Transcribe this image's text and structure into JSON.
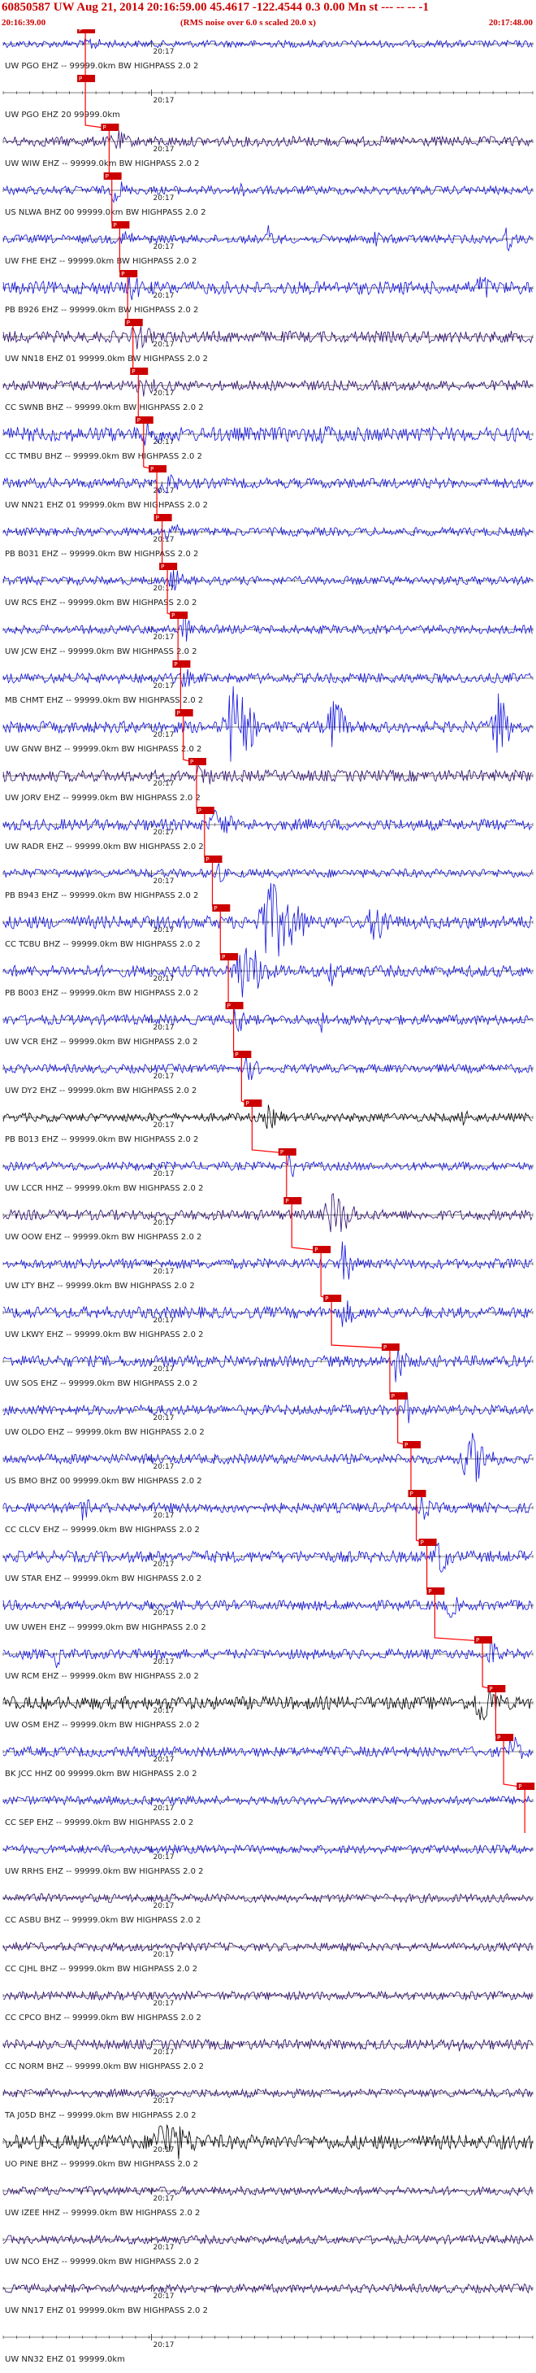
{
  "header": {
    "title": "60850587 UW Aug 21, 2014 20:16:59.00    45.4617 -122.4544   0.3  0.00  Mn st --- -- --   -1",
    "start_time": "20:16:39.00",
    "note": "(RMS noise over 6.0 s scaled 20.0 x)",
    "end_time": "20:17:48.00"
  },
  "colors": {
    "trace_blue": "#1010e0",
    "trace_purple": "#2c0a6e",
    "trace_black": "#000000",
    "pick_red": "#ff0000",
    "pick_box": "#cc0000"
  },
  "chart_data": {
    "type": "seismogram",
    "x_start": "20:16:39.00",
    "x_end": "20:17:48.00",
    "minute_tick": "20:17",
    "traces": [
      {
        "label": "UW PGO EHZ -- 99999.0km BW  HIGHPASS  2.0  2",
        "pick": 0.155,
        "amp": 0.25,
        "color": "blue",
        "bursts": [
          [
            0.16,
            0.05,
            0.6
          ]
        ]
      },
      {
        "label": "UW PGO EHZ 20 99999.0km",
        "pick": 0.155,
        "amp": 0.0,
        "color": "blue",
        "bursts": []
      },
      {
        "label": "UW WIW EHZ -- 99999.0km BW  HIGHPASS  2.0  2",
        "pick": 0.2,
        "amp": 0.35,
        "color": "purple",
        "bursts": [
          [
            0.21,
            0.05,
            0.9
          ],
          [
            0.55,
            0.03,
            0.6
          ]
        ]
      },
      {
        "label": "US NLWA BHZ 00 99999.0km BW  HIGHPASS  2.0  2",
        "pick": 0.205,
        "amp": 0.3,
        "color": "blue",
        "bursts": [
          [
            0.21,
            0.04,
            1.0
          ],
          [
            0.45,
            0.02,
            0.9
          ]
        ]
      },
      {
        "label": "UW FHE EHZ -- 99999.0km BW  HIGHPASS  2.0  2",
        "pick": 0.22,
        "amp": 0.3,
        "color": "blue",
        "bursts": [
          [
            0.23,
            0.04,
            0.8
          ],
          [
            0.5,
            0.02,
            1.2
          ],
          [
            0.7,
            0.02,
            1.0
          ],
          [
            0.95,
            0.02,
            1.1
          ]
        ]
      },
      {
        "label": "PB B926 EHZ -- 99999.0km BW  HIGHPASS  2.0  2",
        "pick": 0.235,
        "amp": 0.45,
        "color": "blue",
        "bursts": [
          [
            0.24,
            0.05,
            1.0
          ],
          [
            0.9,
            0.04,
            1.2
          ]
        ]
      },
      {
        "label": "UW NN18 EHZ 01 99999.0km BW  HIGHPASS  2.0  2",
        "pick": 0.245,
        "amp": 0.4,
        "color": "purple",
        "bursts": [
          [
            0.25,
            0.06,
            1.0
          ],
          [
            0.8,
            0.03,
            0.8
          ]
        ]
      },
      {
        "label": "CC SWNB BHZ -- 99999.0km BW  HIGHPASS  2.0  2",
        "pick": 0.255,
        "amp": 0.35,
        "color": "purple",
        "bursts": [
          [
            0.26,
            0.05,
            0.9
          ]
        ]
      },
      {
        "label": "CC TMBU BHZ -- 99999.0km BW  HIGHPASS  2.0  2",
        "pick": 0.265,
        "amp": 0.5,
        "color": "blue",
        "bursts": [
          [
            0.27,
            0.06,
            1.0
          ],
          [
            0.6,
            0.2,
            0.7
          ]
        ]
      },
      {
        "label": "UW NN21 EHZ 01 99999.0km BW  HIGHPASS  2.0  2",
        "pick": 0.29,
        "amp": 0.35,
        "color": "blue",
        "bursts": [
          [
            0.3,
            0.05,
            1.2
          ]
        ]
      },
      {
        "label": "PB B031 EHZ -- 99999.0km BW  HIGHPASS  2.0  2",
        "pick": 0.3,
        "amp": 0.3,
        "color": "blue",
        "bursts": [
          [
            0.31,
            0.04,
            1.0
          ]
        ]
      },
      {
        "label": "UW RCS EHZ -- 99999.0km BW  HIGHPASS  2.0  2",
        "pick": 0.31,
        "amp": 0.3,
        "color": "blue",
        "bursts": [
          [
            0.32,
            0.04,
            0.9
          ]
        ]
      },
      {
        "label": "UW JCW EHZ -- 99999.0km BW  HIGHPASS  2.0  2",
        "pick": 0.33,
        "amp": 0.3,
        "color": "blue",
        "bursts": [
          [
            0.34,
            0.02,
            1.6
          ]
        ]
      },
      {
        "label": "MB CHMT EHZ -- 99999.0km BW  HIGHPASS  2.0  2",
        "pick": 0.335,
        "amp": 0.35,
        "color": "blue",
        "bursts": [
          [
            0.34,
            0.03,
            0.9
          ]
        ]
      },
      {
        "label": "UW GNW BHZ -- 99999.0km BW  HIGHPASS  2.0  2",
        "pick": 0.34,
        "amp": 0.4,
        "color": "blue",
        "bursts": [
          [
            0.43,
            0.07,
            3.0
          ],
          [
            0.62,
            0.04,
            2.5
          ],
          [
            0.93,
            0.04,
            3.0
          ]
        ]
      },
      {
        "label": "UW JORV EHZ -- 99999.0km BW  HIGHPASS  2.0  2",
        "pick": 0.365,
        "amp": 0.4,
        "color": "purple",
        "bursts": [
          [
            0.37,
            0.05,
            1.0
          ]
        ]
      },
      {
        "label": "UW RADR EHZ -- 99999.0km BW  HIGHPASS  2.0  2",
        "pick": 0.38,
        "amp": 0.4,
        "color": "blue",
        "bursts": [
          [
            0.4,
            0.06,
            1.2
          ]
        ]
      },
      {
        "label": "PB B943 EHZ -- 99999.0km BW  HIGHPASS  2.0  2",
        "pick": 0.395,
        "amp": 0.3,
        "color": "blue",
        "bursts": [
          [
            0.4,
            0.03,
            1.0
          ]
        ]
      },
      {
        "label": "CC TCBU BHZ -- 99999.0km BW  HIGHPASS  2.0  2",
        "pick": 0.41,
        "amp": 0.45,
        "color": "blue",
        "bursts": [
          [
            0.5,
            0.1,
            3.0
          ],
          [
            0.7,
            0.06,
            1.6
          ]
        ]
      },
      {
        "label": "PB B003 EHZ -- 99999.0km BW  HIGHPASS  2.0  2",
        "pick": 0.425,
        "amp": 0.4,
        "color": "blue",
        "bursts": [
          [
            0.45,
            0.08,
            2.2
          ],
          [
            0.62,
            0.04,
            1.2
          ]
        ]
      },
      {
        "label": "UW VCR EHZ -- 99999.0km BW  HIGHPASS  2.0  2",
        "pick": 0.435,
        "amp": 0.35,
        "color": "blue",
        "bursts": [
          [
            0.44,
            0.03,
            1.4
          ],
          [
            0.6,
            0.02,
            1.0
          ]
        ]
      },
      {
        "label": "UW DY2 EHZ -- 99999.0km BW  HIGHPASS  2.0  2",
        "pick": 0.45,
        "amp": 0.3,
        "color": "blue",
        "bursts": [
          [
            0.46,
            0.04,
            1.0
          ]
        ]
      },
      {
        "label": "PB B013 EHZ -- 99999.0km BW  HIGHPASS  2.0  2",
        "pick": 0.47,
        "amp": 0.3,
        "color": "black",
        "bursts": [
          [
            0.5,
            0.05,
            0.9
          ],
          [
            0.87,
            0.03,
            0.8
          ]
        ]
      },
      {
        "label": "UW LCCR HHZ -- 99999.0km BW  HIGHPASS  2.0  2",
        "pick": 0.535,
        "amp": 0.3,
        "color": "blue",
        "bursts": [
          [
            0.54,
            0.02,
            1.4
          ]
        ]
      },
      {
        "label": "UW OOW EHZ -- 99999.0km BW  HIGHPASS  2.0  2",
        "pick": 0.545,
        "amp": 0.35,
        "color": "purple",
        "bursts": [
          [
            0.62,
            0.07,
            1.8
          ]
        ]
      },
      {
        "label": "UW LTY BHZ -- 99999.0km BW  HIGHPASS  2.0  2",
        "pick": 0.6,
        "amp": 0.35,
        "color": "blue",
        "bursts": [
          [
            0.64,
            0.04,
            1.6
          ]
        ]
      },
      {
        "label": "UW LKWY EHZ -- 99999.0km BW  HIGHPASS  2.0  2",
        "pick": 0.62,
        "amp": 0.4,
        "color": "blue",
        "bursts": [
          [
            0.64,
            0.05,
            1.1
          ]
        ]
      },
      {
        "label": "UW SOS EHZ -- 99999.0km BW  HIGHPASS  2.0  2",
        "pick": 0.73,
        "amp": 0.4,
        "color": "blue",
        "bursts": [
          [
            0.74,
            0.04,
            1.5
          ]
        ]
      },
      {
        "label": "UW OLDO EHZ -- 99999.0km BW  HIGHPASS  2.0  2",
        "pick": 0.745,
        "amp": 0.35,
        "color": "blue",
        "bursts": [
          [
            0.76,
            0.02,
            1.4
          ]
        ]
      },
      {
        "label": "US BMO BHZ 00 99999.0km BW  HIGHPASS  2.0  2",
        "pick": 0.77,
        "amp": 0.35,
        "color": "blue",
        "bursts": [
          [
            0.88,
            0.07,
            2.0
          ]
        ]
      },
      {
        "label": "CC CLCV EHZ -- 99999.0km BW  HIGHPASS  2.0  2",
        "pick": 0.78,
        "amp": 0.35,
        "color": "blue",
        "bursts": [
          [
            0.15,
            0.03,
            0.9
          ],
          [
            0.79,
            0.03,
            1.0
          ]
        ]
      },
      {
        "label": "UW STAR EHZ -- 99999.0km BW  HIGHPASS  2.0  2",
        "pick": 0.8,
        "amp": 0.4,
        "color": "blue",
        "bursts": [
          [
            0.82,
            0.04,
            1.6
          ]
        ]
      },
      {
        "label": "UW UWEH EHZ -- 99999.0km BW  HIGHPASS  2.0  2",
        "pick": 0.815,
        "amp": 0.35,
        "color": "blue",
        "bursts": [
          [
            0.84,
            0.04,
            1.0
          ]
        ]
      },
      {
        "label": "UW RCM EHZ -- 99999.0km BW  HIGHPASS  2.0  2",
        "pick": 0.905,
        "amp": 0.35,
        "color": "blue",
        "bursts": [
          [
            0.1,
            0.02,
            1.0
          ],
          [
            0.92,
            0.03,
            1.2
          ]
        ]
      },
      {
        "label": "UW OSM EHZ -- 99999.0km BW  HIGHPASS  2.0  2",
        "pick": 0.93,
        "amp": 0.45,
        "color": "black",
        "bursts": [
          [
            0.9,
            0.06,
            1.8
          ]
        ]
      },
      {
        "label": "BK JCC HHZ 00 99999.0km BW  HIGHPASS  2.0  2",
        "pick": 0.945,
        "amp": 0.35,
        "color": "blue",
        "bursts": [
          [
            0.96,
            0.03,
            1.5
          ]
        ]
      },
      {
        "label": "CC SEP EHZ -- 99999.0km BW  HIGHPASS  2.0  2",
        "pick": 0.985,
        "amp": 0.3,
        "color": "blue",
        "bursts": [
          [
            0.4,
            0.01,
            0.9
          ]
        ]
      },
      {
        "label": "UW RRHS EHZ -- 99999.0km BW  HIGHPASS  2.0  2",
        "pick": null,
        "amp": 0.3,
        "color": "blue",
        "bursts": []
      },
      {
        "label": "CC ASBU BHZ -- 99999.0km BW  HIGHPASS  2.0  2",
        "pick": null,
        "amp": 0.3,
        "color": "purple",
        "bursts": []
      },
      {
        "label": "CC CJHL BHZ -- 99999.0km BW  HIGHPASS  2.0  2",
        "pick": null,
        "amp": 0.3,
        "color": "purple",
        "bursts": []
      },
      {
        "label": "CC CPCO BHZ -- 99999.0km BW  HIGHPASS  2.0  2",
        "pick": null,
        "amp": 0.3,
        "color": "purple",
        "bursts": []
      },
      {
        "label": "CC NORM BHZ -- 99999.0km BW  HIGHPASS  2.0  2",
        "pick": null,
        "amp": 0.35,
        "color": "purple",
        "bursts": [
          [
            0.86,
            0.02,
            0.8
          ]
        ]
      },
      {
        "label": "TA J05D BHZ -- 99999.0km BW  HIGHPASS  2.0  2",
        "pick": null,
        "amp": 0.3,
        "color": "purple",
        "bursts": []
      },
      {
        "label": "UO PINE BHZ -- 99999.0km BW  HIGHPASS  2.0  2",
        "pick": null,
        "amp": 0.5,
        "color": "black",
        "bursts": [
          [
            0.3,
            0.1,
            1.8
          ]
        ]
      },
      {
        "label": "UW IZEE HHZ -- 99999.0km BW  HIGHPASS  2.0  2",
        "pick": null,
        "amp": 0.3,
        "color": "purple",
        "bursts": []
      },
      {
        "label": "UW NCO EHZ -- 99999.0km BW  HIGHPASS  2.0  2",
        "pick": null,
        "amp": 0.3,
        "color": "purple",
        "bursts": []
      },
      {
        "label": "UW NN17 EHZ 01 99999.0km BW  HIGHPASS  2.0  2",
        "pick": null,
        "amp": 0.3,
        "color": "purple",
        "bursts": []
      },
      {
        "label": "UW NN32 EHZ 01 99999.0km",
        "pick": null,
        "amp": 0.0,
        "color": "purple",
        "bursts": []
      }
    ]
  }
}
